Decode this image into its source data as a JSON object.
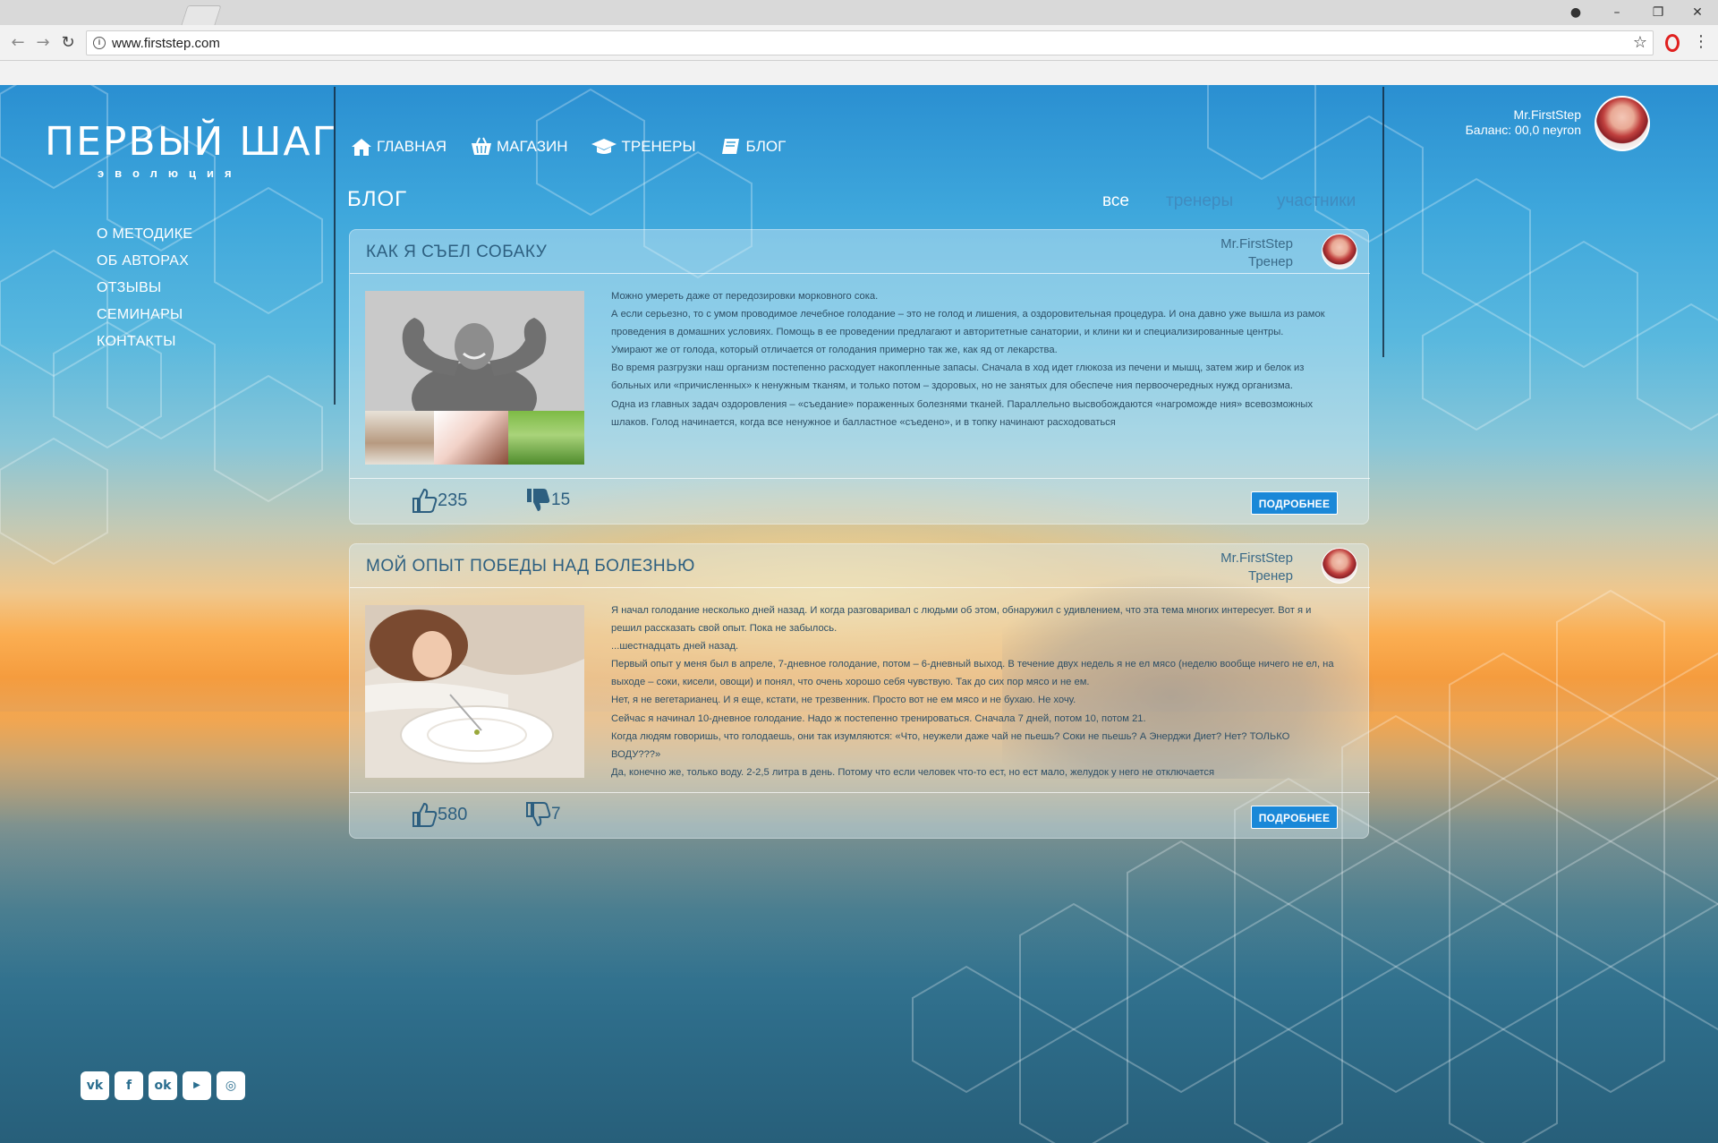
{
  "browser": {
    "url": "www.firststep.com",
    "window_controls": [
      "–",
      "❐",
      "✕"
    ]
  },
  "site": {
    "logo_title": "ПЕРВЫЙ ШАГ",
    "logo_subtitle": "эволюция",
    "side_menu": [
      "О МЕТОДИКЕ",
      "ОБ АВТОРАХ",
      "ОТЗЫВЫ",
      "СЕМИНАРЫ",
      "КОНТАКТЫ"
    ],
    "top_nav": [
      {
        "label": "ГЛАВНАЯ",
        "icon": "home-icon"
      },
      {
        "label": "МАГАЗИН",
        "icon": "basket-icon"
      },
      {
        "label": "ТРЕНЕРЫ",
        "icon": "graduation-cap-icon"
      },
      {
        "label": "БЛОГ",
        "icon": "book-icon"
      }
    ],
    "user": {
      "name": "Mr.FirstStep",
      "balance": "Баланс: 00,0 neyron"
    },
    "section_title": "БЛОГ",
    "filters": [
      {
        "label": "все",
        "active": true
      },
      {
        "label": "тренеры",
        "active": false
      },
      {
        "label": "участники",
        "active": false
      }
    ],
    "socials": [
      "vk-icon",
      "facebook-icon",
      "odnoklassniki-icon",
      "youtube-icon",
      "instagram-icon"
    ]
  },
  "posts": [
    {
      "title": "КАК Я СЪЕЛ СОБАКУ",
      "author": "Mr.FirstStep",
      "role": "Тренер",
      "paragraphs": [
        "Можно умереть даже от передозировки морковного сока.",
        "А если серьезно, то с умом проводимое лечебное голодание – это не голод и лишения, а оздоровительная процедура. И она давно уже вышла из рамок проведения в домашних условиях. Помощь в ее проведении предлагают и авторитетные санатории, и клини ки и специализированные центры.",
        "Умирают же от голода, который отличается от голодания примерно так же, как яд от лекарства.",
        "Во время разгрузки наш организм постепенно расходует накопленные запасы. Сначала в ход идет глюкоза из печени и мышц, затем жир и белок из больных или «причисленных» к ненужным тканям, и только потом – здоровых, но не занятых для обеспече ния первоочередных нужд организма.",
        "Одна из главных задач оздоровления – «съедание» пораженных болезнями тканей. Параллельно высвобождаются «нагроможде ния» всевозможных шлаков. Голод начинается, когда все ненужное и балластное «съедено», и в топку начинают расходоваться"
      ],
      "likes": "235",
      "dislikes": "15",
      "more": "ПОДРОБНЕЕ"
    },
    {
      "title": "МОЙ ОПЫТ ПОБЕДЫ НАД БОЛЕЗНЬЮ",
      "author": "Mr.FirstStep",
      "role": "Тренер",
      "paragraphs": [
        "Я начал голодание несколько дней назад. И когда разговаривал с людьми об этом, обнаружил с удивлением, что эта тема многих интересует. Вот я и решил рассказать свой опыт. Пока не забылось.",
        "...шестнадцать дней назад.",
        "Первый опыт у меня был в апреле, 7-дневное голодание, потом – 6-дневный выход. В течение двух недель я не ел мясо (неделю вообще ничего не ел, на выходе – соки, кисели, овощи) и понял, что очень хорошо себя чувствую. Так до сих пор мясо и не ем.",
        "Нет, я не вегетарианец. И я еще, кстати, не трезвенник. Просто вот не ем мясо и не бухаю. Не хочу.",
        "Сейчас я начинал 10-дневное голодание. Надо ж постепенно тренироваться. Сначала 7 дней, потом 10, потом 21.",
        "Когда людям говоришь, что голодаешь, они так изумляются: «Что, неужели даже чай не пьешь? Соки не пьешь? А Энерджи Диет? Нет? ТОЛЬКО ВОДУ???»",
        "Да, конечно же, только воду. 2-2,5 литра в день. Потому что если человек что-то ест, но ест мало, желудок у него не отключается"
      ],
      "likes": "580",
      "dislikes": "7",
      "more": "ПОДРОБНЕЕ"
    }
  ]
}
